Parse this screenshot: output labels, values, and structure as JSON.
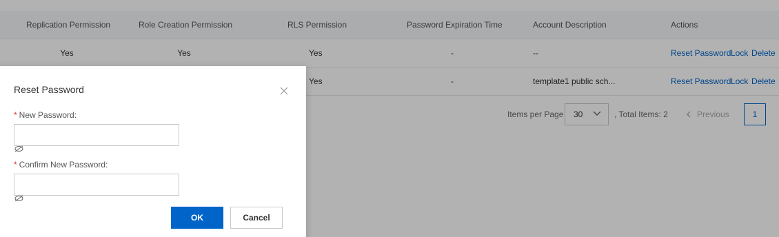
{
  "table": {
    "headers": [
      "Replication Permission",
      "Role Creation Permission",
      "RLS Permission",
      "Password Expiration Time",
      "Account Description",
      "Actions"
    ],
    "rows": [
      {
        "replication": "Yes",
        "role_creation": "Yes",
        "rls": "Yes",
        "expiration": "-",
        "description": "--",
        "actions": [
          "Reset Password",
          "Lock",
          "Delete"
        ]
      },
      {
        "replication": "",
        "role_creation": "",
        "rls": "Yes",
        "expiration": "-",
        "description": "template1 public sch...",
        "actions": [
          "Reset Password",
          "Lock",
          "Delete"
        ]
      }
    ]
  },
  "pagination": {
    "items_per_page_label": "Items per Page",
    "items_per_page": "30",
    "total_items": ", Total Items: 2",
    "previous": "Previous",
    "current_page": "1"
  },
  "dialog": {
    "title": "Reset Password",
    "new_password_label": "New Password:",
    "new_password_value": "",
    "confirm_password_label": "Confirm New Password:",
    "confirm_password_value": "",
    "required_mark": "*",
    "ok_label": "OK",
    "cancel_label": "Cancel"
  },
  "icons": {
    "close": "close-icon",
    "eye": "eye-off-icon",
    "chevron_down": "chevron-down-icon",
    "chevron_left": "chevron-left-icon"
  },
  "colors": {
    "primary": "#0064c8",
    "required": "#d93026",
    "header_bg": "#f5f6f8"
  }
}
